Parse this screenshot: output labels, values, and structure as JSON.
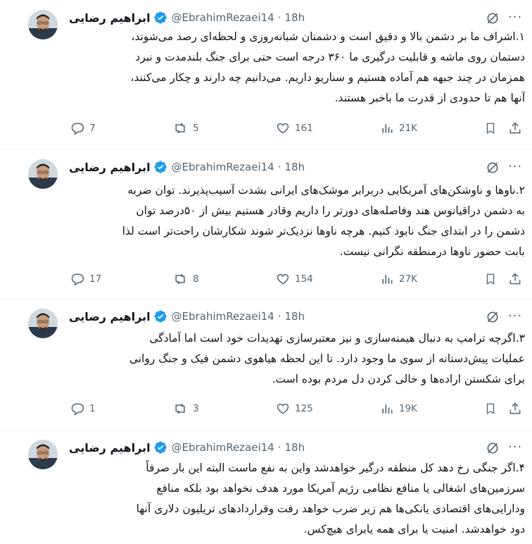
{
  "tweets": [
    {
      "author": "ابراهیم رضایی",
      "handle": "@EbrahimRezaei14",
      "time": "18h",
      "lines": [
        "۱.اشراف ما بر دشمن بالا و دقیق است و دشمنان شبانه‌روزی و لحظه‌ای رصد می‌شوند،",
        "دستمان روی ماشه و قابلیت درگیری ما ۳۶۰ درجه است حتی برای جنگ بلندمدت و نبرد",
        "همزمان در چند جبهه هم آماده هستیم و سناریو داریم. می‌دانیم چه دارند و چکار می‌کنند،",
        "آنها هم تا حدودی از قدرت ما باخبر هستند."
      ],
      "replies": "7",
      "retweets": "5",
      "likes": "161",
      "views": "21K"
    },
    {
      "author": "ابراهیم رضایی",
      "handle": "@EbrahimRezaei14",
      "time": "18h",
      "lines": [
        "۲.ناوها و ناوشکن‌های آمریکایی دربرابر موشک‌های ایرانی بشدت آسیب‌پذیرند. توان ضربه",
        "به دشمن دراقیانوس هند وفاصله‌های دورتر را داریم وقادر هستیم بیش از ۵۰درصد توان",
        "دشمن را در ابتدای جنگ نابود کنیم. هرچه ناوها نزدیک‌تر شوند شکارشان راحت‌تر است لذا",
        "بابت حضور ناوها درمنطقه نگرانی نیست."
      ],
      "replies": "17",
      "retweets": "8",
      "likes": "154",
      "views": "27K"
    },
    {
      "author": "ابراهیم رضایی",
      "handle": "@EbrahimRezaei14",
      "time": "18h",
      "lines": [
        "۳.اگرچه ترامپ به دنبال هیمنه‌سازی و نیز معتبرسازی تهدیدات خود است اما آمادگی",
        "عملیات پیش‌دستانه از سوی ما وجود دارد. تا این لحظه هیاهوی دشمن فیک و جنگ روانی",
        "برای شکستن اراده‌ها و خالی کردن دل مردم بوده است."
      ],
      "replies": "1",
      "retweets": "3",
      "likes": "125",
      "views": "19K"
    },
    {
      "author": "ابراهیم رضایی",
      "handle": "@EbrahimRezaei14",
      "time": "18h",
      "lines": [
        "۴.اگر جنگی رخ دهد کل منطقه درگیر خواهدشد واین به نفع ماست البته این بار صرفاً",
        "سرزمین‌های اشغالی یا منافع نظامی رژیم آمریکا مورد هدف نخواهد بود بلکه منافع",
        "ودارایی‌های اقتصادی یانکی‌ها هم زیر ضرب خواهد رفت وقراردادهای تریلیون دلاری آنها",
        "دود خواهدشد. امنیت یا برای همه یابرای هیچ‌کس."
      ]
    }
  ],
  "icons": {
    "verified": "verified-badge-icon",
    "grok": "grok-icon",
    "more": "more-icon",
    "reply": "reply-icon",
    "retweet": "retweet-icon",
    "like": "like-icon",
    "views": "views-icon",
    "bookmark": "bookmark-icon",
    "share": "share-icon"
  },
  "colors": {
    "verified": "#1d9bf0",
    "text": "#0f1419",
    "secondary": "#536471"
  }
}
